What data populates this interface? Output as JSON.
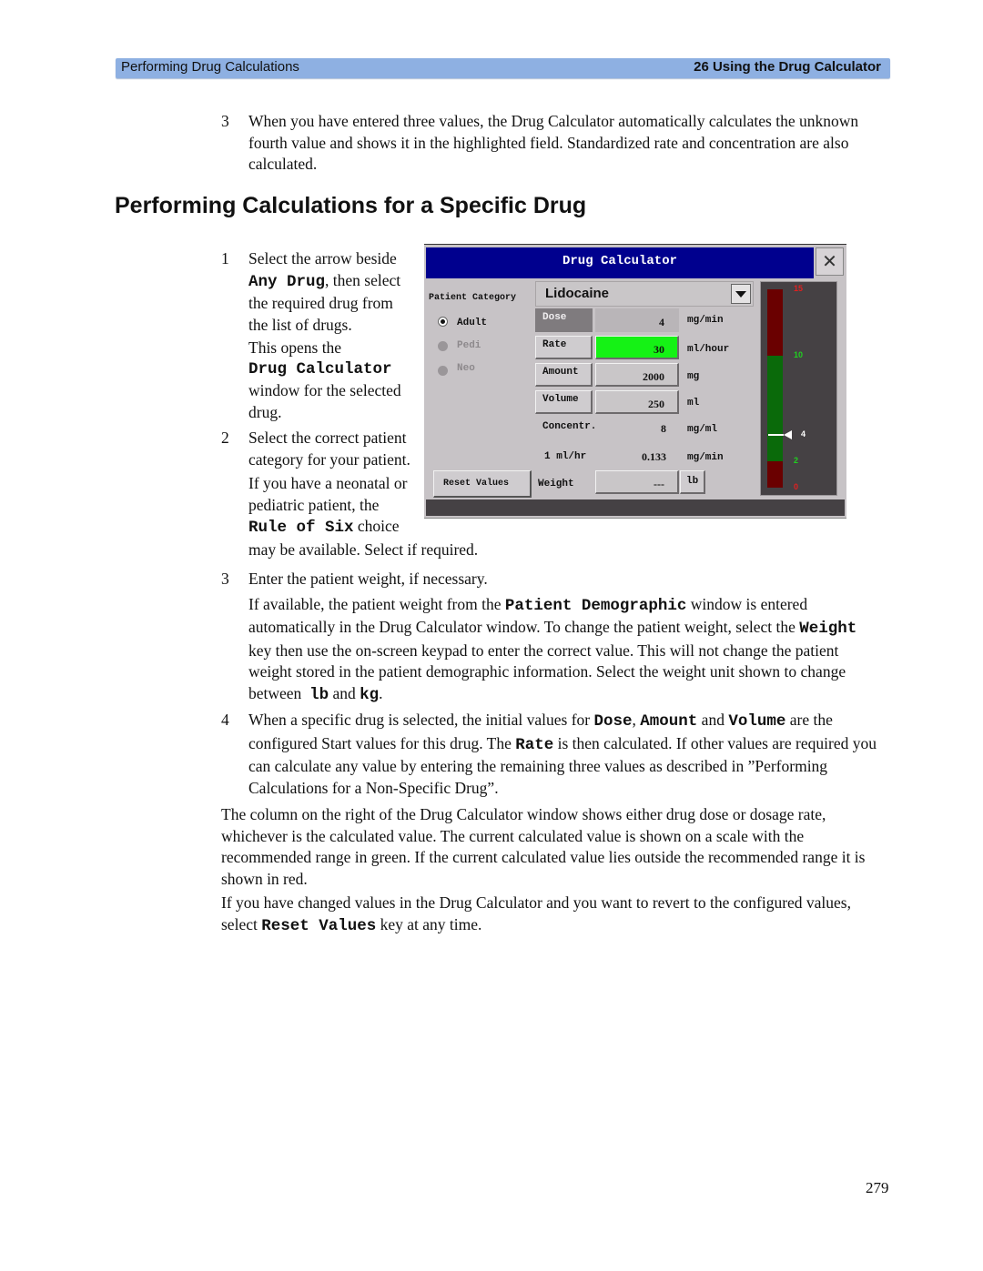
{
  "header": {
    "section": "Performing Drug Calculations",
    "chapter": "26  Using the Drug Calculator",
    "bar_color": "#8eb0e2"
  },
  "intro_step": {
    "number": "3",
    "lines": [
      "When you have entered three values, the Drug Calculator automatically calculates the unknown",
      "fourth value and shows it in the highlighted field. Standardized rate and concentration are also",
      "calculated."
    ]
  },
  "section_title": "Performing Calculations for a Specific Drug",
  "steps": {
    "s1": {
      "number": "1",
      "l1": "Select the arrow beside",
      "l2_code": "Any Drug",
      "l2_rest": ", then select",
      "l3": "the required drug from",
      "l4": "the list of drugs.",
      "l5": "This opens the",
      "l6_code": "Drug Calculator",
      "l7": "window for the selected",
      "l8": "drug."
    },
    "s2": {
      "number": "2",
      "l1": "Select the correct patient",
      "l2": "category for your patient.",
      "l3": "If you have a neonatal or",
      "l4": "pediatric patient, the",
      "l5_code": "Rule of Six",
      "l5_rest": " choice",
      "l6": "may be available. Select if required."
    },
    "s3": {
      "number": "3",
      "l1": "Enter the patient weight, if necessary.",
      "p_l1_a": "If available, the patient weight from the ",
      "p_l1_code": "Patient Demographic",
      "p_l1_b": " window is entered",
      "p_l2_a": "automatically in the Drug Calculator window. To change the patient weight, select the ",
      "p_l2_code": "Weight",
      "p_l3": "key then use the on-screen keypad to enter the correct value. This will not change the patient",
      "p_l4": "weight stored in the patient demographic information. Select the weight unit shown to change",
      "p_l5_a": "between  ",
      "p_l5_code1": "lb",
      "p_l5_b": " and ",
      "p_l5_code2": "kg",
      "p_l5_c": "."
    },
    "s4": {
      "number": "4",
      "l1_a": "When a specific drug is selected, the initial values for ",
      "l1_code1": "Dose",
      "l1_b": ", ",
      "l1_code2": "Amount",
      "l1_c": " and ",
      "l1_code3": "Volume",
      "l1_d": " are the",
      "l2_a": "configured Start values for this drug. The ",
      "l2_code": "Rate",
      "l2_b": " is then calculated. If other values are required you",
      "l3": "can calculate any value by entering the remaining three values as described in ”Performing",
      "l4": "Calculations for a Non-Specific Drug”."
    }
  },
  "para1": [
    "The column on the right of the Drug Calculator window shows either drug dose or dosage rate,",
    "whichever is the calculated value. The current calculated value is shown on a scale with the",
    "recommended range in green. If the current calculated value lies outside the recommended range it is",
    "shown in red."
  ],
  "para2": {
    "l1": "If you have changed values in the Drug Calculator and you want to revert to the configured values,",
    "l2_a": "select ",
    "l2_code": "Reset Values",
    "l2_b": " key at any time."
  },
  "calculator": {
    "title": "Drug Calculator",
    "close_icon": "close-x-icon",
    "patient_category_label": "Patient Category",
    "categories": [
      {
        "label": "Adult",
        "selected": true,
        "enabled": true
      },
      {
        "label": "Pedi",
        "selected": false,
        "enabled": false
      },
      {
        "label": "Neo",
        "selected": false,
        "enabled": false
      }
    ],
    "drug_selected": "Lidocaine",
    "fields": [
      {
        "key": "Dose",
        "value": "4",
        "unit": "mg/min",
        "state": "active"
      },
      {
        "key": "Rate",
        "value": "30",
        "unit": "ml/hour",
        "state": "calculated"
      },
      {
        "key": "Amount",
        "value": "2000",
        "unit": "mg",
        "state": "normal"
      },
      {
        "key": "Volume",
        "value": "250",
        "unit": "ml",
        "state": "normal"
      }
    ],
    "concentration": {
      "label": "Concentr.",
      "value": "8",
      "unit": "mg/ml"
    },
    "standard_rate": {
      "label": "1 ml/hr",
      "value": "0.133",
      "unit": "mg/min"
    },
    "reset_label": "Reset Values",
    "weight": {
      "label": "Weight",
      "value": "---",
      "unit": "lb"
    },
    "highlight_color": "#15f215",
    "title_bar_color": "#00008e",
    "scale": {
      "min": 0,
      "max": 15,
      "recommended_low": 2,
      "recommended_high": 10,
      "current": 4,
      "ticks": [
        {
          "value": "15",
          "color": "#e02020"
        },
        {
          "value": "10",
          "color": "#20d020"
        },
        {
          "value": "4",
          "color": "#ffffff"
        },
        {
          "value": "2",
          "color": "#20d020"
        },
        {
          "value": "0",
          "color": "#e02020"
        }
      ],
      "in_range_color": "#0a6a0a",
      "out_range_color": "#6a0000"
    }
  },
  "page_number": "279"
}
